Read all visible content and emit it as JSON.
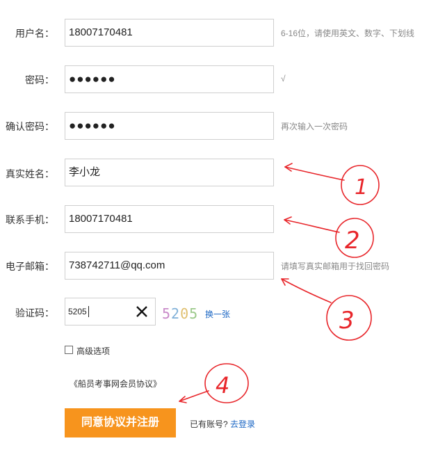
{
  "form": {
    "username": {
      "label": "用户名：",
      "value": "18007170481",
      "hint": "6-16位，请使用英文、数字、下划线"
    },
    "password": {
      "label": "密码：",
      "value": "●●●●●●",
      "hint": "√"
    },
    "confirm_password": {
      "label": "确认密码：",
      "value": "●●●●●●",
      "hint": "再次输入一次密码"
    },
    "real_name": {
      "label": "真实姓名：",
      "value": "李小龙"
    },
    "phone": {
      "label": "联系手机：",
      "value": "18007170481"
    },
    "email": {
      "label": "电子邮箱：",
      "value": "738742711@qq.com",
      "hint": "请填写真实邮箱用于找回密码"
    },
    "captcha": {
      "label": "验证码：",
      "value": "5205",
      "image_chars": [
        "5",
        "2",
        "0",
        "5"
      ],
      "image_colors": [
        "#c98ac9",
        "#7fb0d8",
        "#e0c070",
        "#9bc98a"
      ],
      "refresh_label": "换一张"
    },
    "advanced_options_label": "高级选项",
    "advanced_options_checked": false,
    "agreement_link": "《船员考事网会员协议》",
    "submit_label": "同意协议并注册",
    "have_account_text": "已有账号?",
    "login_link": "去登录"
  },
  "annotations": {
    "color": "#e8252a",
    "numbers": [
      "1",
      "2",
      "3",
      "4"
    ]
  }
}
